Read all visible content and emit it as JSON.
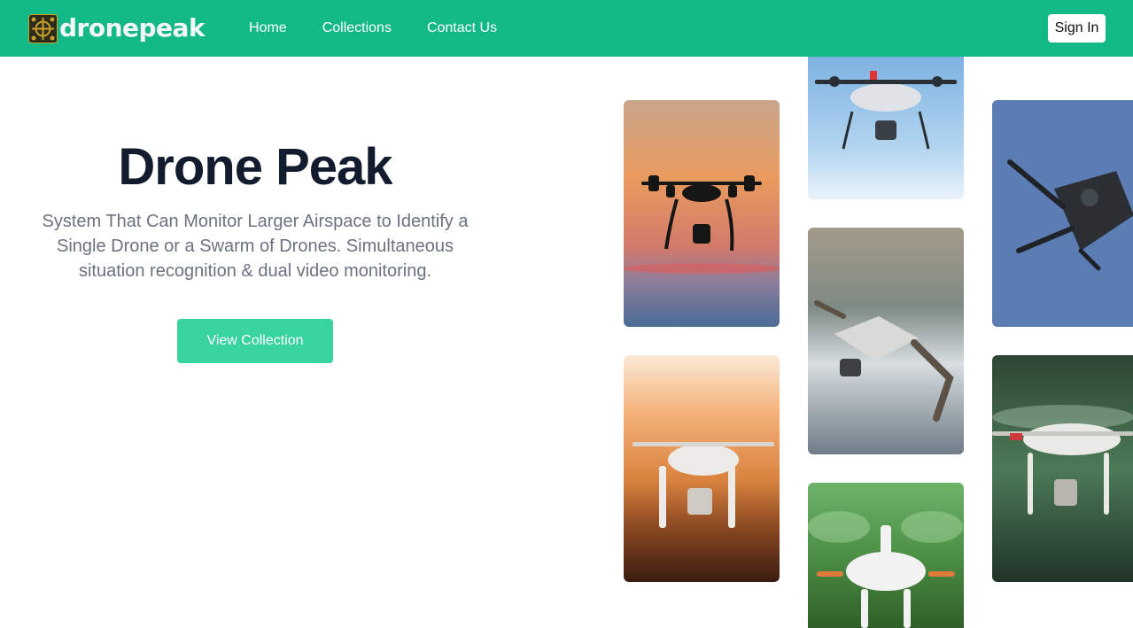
{
  "header": {
    "brand_name": "dronepeak",
    "nav": [
      {
        "label": "Home"
      },
      {
        "label": "Collections"
      },
      {
        "label": "Contact Us"
      }
    ],
    "sign_in_label": "Sign In",
    "background_color": "#12b886"
  },
  "hero": {
    "title": "Drone Peak",
    "description": "System That Can Monitor Larger Airspace to Identify a Single Drone or a Swarm of Drones. Simultaneous situation recognition & dual video monitoring.",
    "cta_label": "View Collection",
    "cta_color": "#38d39f"
  },
  "gallery": {
    "images": [
      {
        "subject": "drone silhouette at sunset"
      },
      {
        "subject": "white quadcopter in blue sky"
      },
      {
        "subject": "folded-arm drone against blue sky"
      },
      {
        "subject": "white drone at golden hour"
      },
      {
        "subject": "compact grey drone close-up"
      },
      {
        "subject": "white drone with green blurred background"
      },
      {
        "subject": "white drone over dark green forest"
      }
    ]
  }
}
